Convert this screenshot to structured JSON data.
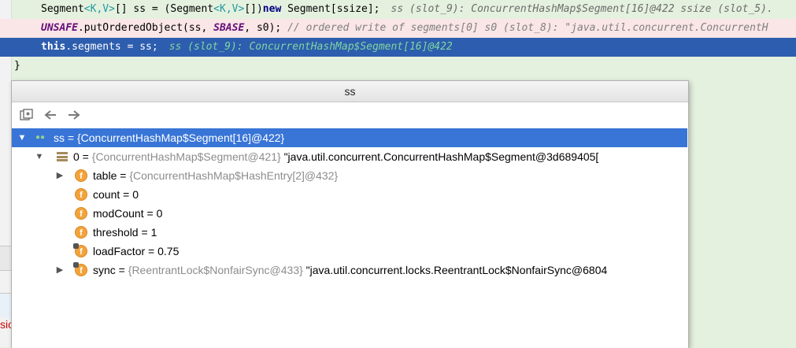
{
  "code": {
    "line1": {
      "text_a": "Segment",
      "text_b": "<K,V>",
      "text_c": "[] ss = (Segment",
      "text_d": "<K,V>",
      "text_e": "[])",
      "kw_new": "new",
      "text_f": " Segment[ssize];",
      "inline": "ss (slot_9): ConcurrentHashMap$Segment[16]@422  ssize (slot_5)."
    },
    "line2": {
      "unsafe": "UNSAFE",
      "text_a": ".putOrderedObject(ss, ",
      "sbase": "SBASE",
      "text_b": ", s0);",
      "comment": "// ordered write of segments[0]  s0 (slot_8): \"java.util.concurrent.ConcurrentH"
    },
    "line3": {
      "kw_this": "this",
      "text_a": ".segments = ss;",
      "inline": "ss (slot_9): ConcurrentHashMap$Segment[16]@422"
    },
    "line4": {
      "text": "}"
    }
  },
  "popup": {
    "title": "ss",
    "toolbar": {
      "back_icon": "arrow-left-icon",
      "forward_icon": "arrow-right-icon",
      "copy_icon": "copy-icon"
    },
    "tree": [
      {
        "name": "ss",
        "eq": " = ",
        "type": "{ConcurrentHashMap$Segment[16]@422}",
        "value": ""
      },
      {
        "name": "0",
        "eq": " = ",
        "type": "{ConcurrentHashMap$Segment@421}",
        "value": " \"java.util.concurrent.ConcurrentHashMap$Segment@3d689405["
      },
      {
        "name": "table",
        "eq": " = ",
        "type": "{ConcurrentHashMap$HashEntry[2]@432}",
        "value": ""
      },
      {
        "name": "count",
        "eq": " = ",
        "type": "",
        "value": "0"
      },
      {
        "name": "modCount",
        "eq": " = ",
        "type": "",
        "value": "0"
      },
      {
        "name": "threshold",
        "eq": " = ",
        "type": "",
        "value": "1"
      },
      {
        "name": "loadFactor",
        "eq": " = ",
        "type": "",
        "value": "0.75"
      },
      {
        "name": "sync",
        "eq": " = ",
        "type": "{ReentrantLock$NonfairSync@433}",
        "value": " \"java.util.concurrent.locks.ReentrantLock$NonfairSync@6804"
      }
    ]
  },
  "side": {
    "text": "sio"
  }
}
